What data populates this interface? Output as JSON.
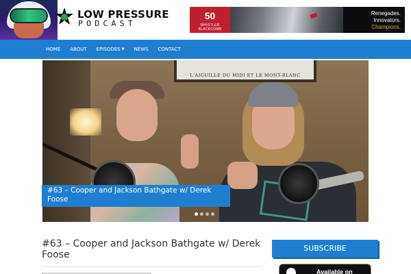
{
  "header": {
    "logo_line1": "LOW PRESSURE",
    "logo_line2": "PODCAST"
  },
  "ad": {
    "brand_number": "50",
    "brand_name": "WHISTLER BLACKCOMB",
    "tagline1": "Renegades.",
    "tagline2": "Innovators.",
    "tagline3": "Champions.",
    "brand_color": "#c0202e",
    "accent_color": "#d9a84e"
  },
  "nav": {
    "items": [
      {
        "label": "HOME"
      },
      {
        "label": "ABOUT"
      },
      {
        "label": "EPISODES",
        "has_dropdown": true
      },
      {
        "label": "NEWS"
      },
      {
        "label": "CONTACT"
      }
    ],
    "color": "#1e7fd1"
  },
  "hero": {
    "frame_caption": "L'AIGUILLE DU MIDI ET LE MONT-BLANC",
    "caption": "#63 – Cooper and Jackson Bathgate w/ Derek Foose",
    "slides": 4,
    "active_slide": 1
  },
  "post": {
    "title": "#63 – Cooper and Jackson Bathgate w/ Derek Foose"
  },
  "sidebar": {
    "subscribe_label": "SUBSCRIBE",
    "appstore_label": "Available on"
  }
}
